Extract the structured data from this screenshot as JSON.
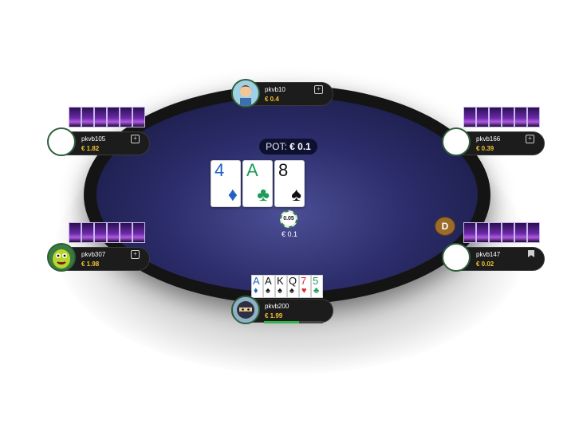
{
  "pot": {
    "label": "POT:",
    "amount": "€ 0.1"
  },
  "board": [
    {
      "rank": "4",
      "suit": "♦",
      "color": "blue"
    },
    {
      "rank": "A",
      "suit": "♣",
      "color": "green"
    },
    {
      "rank": "8",
      "suit": "♠",
      "color": "black"
    }
  ],
  "chip": {
    "value": "0.05",
    "bet": "€ 0.1"
  },
  "dealer_button": "D",
  "players": {
    "top": {
      "name": "pkvb10",
      "stack": "€ 0.4"
    },
    "upper_left": {
      "name": "pkvb105",
      "stack": "€ 1.82"
    },
    "upper_right": {
      "name": "pkvb166",
      "stack": "€ 0.39"
    },
    "lower_left": {
      "name": "pkvb307",
      "stack": "€ 1.98"
    },
    "lower_right": {
      "name": "pkvb147",
      "stack": "€ 0.02"
    },
    "hero": {
      "name": "pkvb200",
      "stack": "€ 1.99",
      "timer_fraction": 0.6
    }
  },
  "hero_cards": [
    {
      "rank": "A",
      "suit": "♦",
      "color": "blue"
    },
    {
      "rank": "A",
      "suit": "♠",
      "color": "black"
    },
    {
      "rank": "K",
      "suit": "♠",
      "color": "black"
    },
    {
      "rank": "Q",
      "suit": "♠",
      "color": "black"
    },
    {
      "rank": "7",
      "suit": "♥",
      "color": "red"
    },
    {
      "rank": "5",
      "suit": "♣",
      "color": "green"
    }
  ],
  "icons": {
    "add": "+"
  }
}
